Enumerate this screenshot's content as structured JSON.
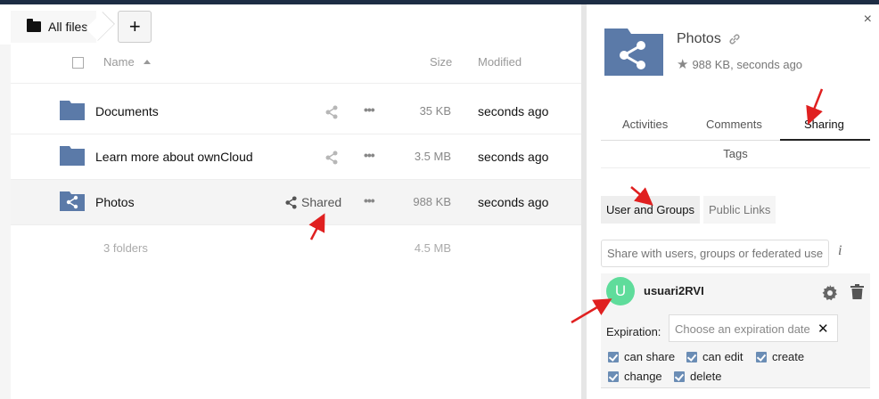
{
  "breadcrumb": {
    "home_label": "All files",
    "add_label": "+"
  },
  "file_list": {
    "headers": {
      "name": "Name",
      "size": "Size",
      "modified": "Modified"
    },
    "rows": [
      {
        "name": "Documents",
        "size": "35 KB",
        "modified": "seconds ago",
        "shared": false
      },
      {
        "name": "Learn more about ownCloud",
        "size": "3.5 MB",
        "modified": "seconds ago",
        "shared": false
      },
      {
        "name": "Photos",
        "size": "988 KB",
        "modified": "seconds ago",
        "shared": true,
        "shared_label": "Shared"
      }
    ],
    "summary": {
      "count": "3 folders",
      "total": "4.5 MB"
    }
  },
  "details": {
    "title": "Photos",
    "meta": "988 KB, seconds ago",
    "tabs": [
      "Activities",
      "Comments",
      "Sharing"
    ],
    "active_tab": "Sharing",
    "tags_label": "Tags",
    "subtabs": [
      "User and Groups",
      "Public Links"
    ],
    "share_placeholder": "Share with users, groups or federated users …",
    "info_icon": "i",
    "close_icon": "×",
    "share_entry": {
      "avatar_letter": "U",
      "username": "usuari2RVI",
      "expiration_label": "Expiration:",
      "expiration_placeholder": "Choose an expiration date",
      "clear_icon": "✕",
      "permissions": [
        "can share",
        "can edit",
        "create",
        "change",
        "delete"
      ]
    }
  },
  "colors": {
    "folder": "#5b7aa8",
    "avatar": "#5fdc9b",
    "arrow": "#e02020",
    "topbar": "#1d2d44"
  }
}
